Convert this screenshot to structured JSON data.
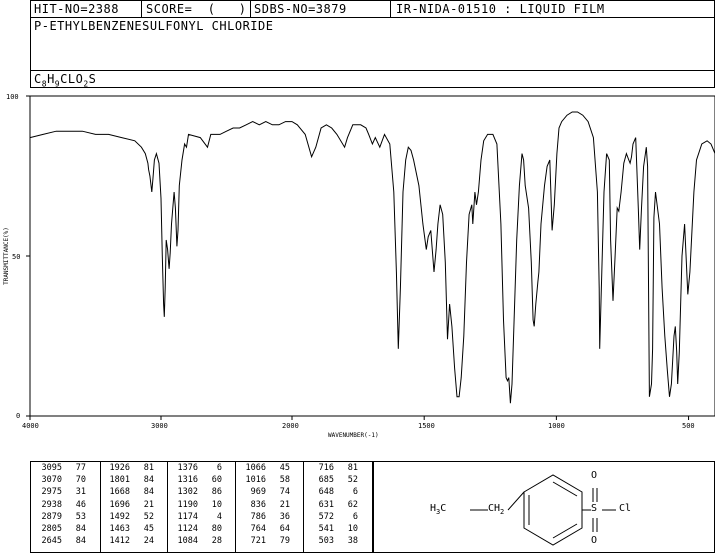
{
  "header": {
    "hit_no": "HIT-NO=2388",
    "score": "SCORE=  (   )",
    "sdbs_no": "SDBS-NO=3879",
    "ir_info": "IR-NIDA-01510 : LIQUID FILM",
    "compound": "P-ETHYLBENZENESULFONYL CHLORIDE",
    "formula_parts": [
      "C",
      "8",
      "H",
      "9",
      "CLO",
      "2",
      "S"
    ]
  },
  "chart_data": {
    "type": "line",
    "xlabel": "WAVENUMBER(-1)",
    "ylabel": "TRANSMITTANCE(%)",
    "x_ticks": [
      "4000",
      "3000",
      "2000",
      "1500",
      "1000",
      "500"
    ],
    "y_ticks": [
      "100",
      "50",
      "0"
    ],
    "xlim": [
      4000,
      400
    ],
    "ylim": [
      0,
      100
    ],
    "series": [
      {
        "points": [
          [
            4000,
            87
          ],
          [
            3900,
            88
          ],
          [
            3800,
            89
          ],
          [
            3700,
            89
          ],
          [
            3600,
            89
          ],
          [
            3500,
            88
          ],
          [
            3400,
            88
          ],
          [
            3300,
            87
          ],
          [
            3200,
            86
          ],
          [
            3150,
            84
          ],
          [
            3120,
            82
          ],
          [
            3100,
            79
          ],
          [
            3095,
            77
          ],
          [
            3085,
            75
          ],
          [
            3070,
            70
          ],
          [
            3062,
            74
          ],
          [
            3050,
            80
          ],
          [
            3035,
            82
          ],
          [
            3015,
            79
          ],
          [
            3000,
            68
          ],
          [
            2990,
            50
          ],
          [
            2980,
            35
          ],
          [
            2975,
            31
          ],
          [
            2968,
            40
          ],
          [
            2960,
            55
          ],
          [
            2950,
            52
          ],
          [
            2938,
            46
          ],
          [
            2930,
            51
          ],
          [
            2920,
            60
          ],
          [
            2900,
            70
          ],
          [
            2890,
            65
          ],
          [
            2879,
            53
          ],
          [
            2870,
            58
          ],
          [
            2860,
            72
          ],
          [
            2840,
            80
          ],
          [
            2820,
            85
          ],
          [
            2805,
            84
          ],
          [
            2790,
            88
          ],
          [
            2700,
            87
          ],
          [
            2645,
            84
          ],
          [
            2620,
            88
          ],
          [
            2550,
            88
          ],
          [
            2500,
            89
          ],
          [
            2450,
            90
          ],
          [
            2400,
            90
          ],
          [
            2350,
            91
          ],
          [
            2300,
            92
          ],
          [
            2250,
            91
          ],
          [
            2200,
            92
          ],
          [
            2150,
            91
          ],
          [
            2100,
            91
          ],
          [
            2050,
            92
          ],
          [
            2000,
            92
          ],
          [
            1980,
            91
          ],
          [
            1950,
            88
          ],
          [
            1926,
            81
          ],
          [
            1910,
            84
          ],
          [
            1890,
            90
          ],
          [
            1870,
            91
          ],
          [
            1850,
            90
          ],
          [
            1830,
            88
          ],
          [
            1801,
            84
          ],
          [
            1790,
            87
          ],
          [
            1770,
            91
          ],
          [
            1740,
            91
          ],
          [
            1720,
            90
          ],
          [
            1710,
            88
          ],
          [
            1696,
            85
          ],
          [
            1685,
            87
          ],
          [
            1668,
            84
          ],
          [
            1650,
            88
          ],
          [
            1630,
            85
          ],
          [
            1615,
            70
          ],
          [
            1605,
            45
          ],
          [
            1598,
            21
          ],
          [
            1590,
            40
          ],
          [
            1580,
            70
          ],
          [
            1570,
            80
          ],
          [
            1560,
            84
          ],
          [
            1550,
            83
          ],
          [
            1540,
            80
          ],
          [
            1520,
            72
          ],
          [
            1505,
            60
          ],
          [
            1492,
            52
          ],
          [
            1485,
            56
          ],
          [
            1475,
            58
          ],
          [
            1463,
            45
          ],
          [
            1455,
            52
          ],
          [
            1448,
            60
          ],
          [
            1440,
            66
          ],
          [
            1430,
            63
          ],
          [
            1420,
            48
          ],
          [
            1412,
            24
          ],
          [
            1404,
            35
          ],
          [
            1395,
            28
          ],
          [
            1385,
            15
          ],
          [
            1376,
            6
          ],
          [
            1368,
            6
          ],
          [
            1360,
            12
          ],
          [
            1350,
            25
          ],
          [
            1340,
            48
          ],
          [
            1330,
            63
          ],
          [
            1320,
            66
          ],
          [
            1316,
            60
          ],
          [
            1308,
            70
          ],
          [
            1302,
            66
          ],
          [
            1295,
            70
          ],
          [
            1285,
            80
          ],
          [
            1275,
            86
          ],
          [
            1260,
            88
          ],
          [
            1240,
            88
          ],
          [
            1225,
            85
          ],
          [
            1210,
            60
          ],
          [
            1200,
            30
          ],
          [
            1190,
            12
          ],
          [
            1185,
            11
          ],
          [
            1180,
            12
          ],
          [
            1174,
            4
          ],
          [
            1168,
            10
          ],
          [
            1160,
            30
          ],
          [
            1150,
            55
          ],
          [
            1140,
            72
          ],
          [
            1130,
            82
          ],
          [
            1124,
            80
          ],
          [
            1118,
            72
          ],
          [
            1105,
            65
          ],
          [
            1095,
            48
          ],
          [
            1088,
            30
          ],
          [
            1084,
            28
          ],
          [
            1078,
            35
          ],
          [
            1070,
            42
          ],
          [
            1066,
            45
          ],
          [
            1058,
            60
          ],
          [
            1045,
            72
          ],
          [
            1035,
            78
          ],
          [
            1025,
            80
          ],
          [
            1016,
            58
          ],
          [
            1008,
            66
          ],
          [
            998,
            82
          ],
          [
            990,
            90
          ],
          [
            980,
            92
          ],
          [
            960,
            94
          ],
          [
            940,
            95
          ],
          [
            920,
            95
          ],
          [
            900,
            94
          ],
          [
            880,
            92
          ],
          [
            860,
            87
          ],
          [
            845,
            70
          ],
          [
            838,
            40
          ],
          [
            836,
            21
          ],
          [
            828,
            45
          ],
          [
            820,
            70
          ],
          [
            810,
            82
          ],
          [
            800,
            80
          ],
          [
            795,
            55
          ],
          [
            786,
            36
          ],
          [
            778,
            50
          ],
          [
            770,
            65
          ],
          [
            764,
            64
          ],
          [
            755,
            70
          ],
          [
            745,
            79
          ],
          [
            735,
            82
          ],
          [
            726,
            80
          ],
          [
            721,
            79
          ],
          [
            716,
            81
          ],
          [
            710,
            85
          ],
          [
            700,
            87
          ],
          [
            690,
            65
          ],
          [
            685,
            52
          ],
          [
            678,
            65
          ],
          [
            670,
            78
          ],
          [
            660,
            84
          ],
          [
            655,
            78
          ],
          [
            648,
            6
          ],
          [
            640,
            10
          ],
          [
            636,
            21
          ],
          [
            631,
            62
          ],
          [
            625,
            70
          ],
          [
            610,
            60
          ],
          [
            600,
            40
          ],
          [
            590,
            25
          ],
          [
            580,
            14
          ],
          [
            572,
            6
          ],
          [
            565,
            10
          ],
          [
            555,
            25
          ],
          [
            550,
            28
          ],
          [
            545,
            20
          ],
          [
            541,
            10
          ],
          [
            535,
            20
          ],
          [
            525,
            50
          ],
          [
            515,
            60
          ],
          [
            503,
            38
          ],
          [
            495,
            45
          ],
          [
            480,
            70
          ],
          [
            470,
            80
          ],
          [
            450,
            85
          ],
          [
            430,
            86
          ],
          [
            415,
            85
          ],
          [
            400,
            82
          ]
        ]
      }
    ]
  },
  "peak_table": [
    [
      [
        "3095",
        "77"
      ],
      [
        "3070",
        "70"
      ],
      [
        "2975",
        "31"
      ],
      [
        "2938",
        "46"
      ],
      [
        "2879",
        "53"
      ],
      [
        "2805",
        "84"
      ],
      [
        "2645",
        "84"
      ]
    ],
    [
      [
        "1926",
        "81"
      ],
      [
        "1801",
        "84"
      ],
      [
        "1668",
        "84"
      ],
      [
        "1696",
        "21"
      ],
      [
        "1492",
        "52"
      ],
      [
        "1463",
        "45"
      ],
      [
        "1412",
        "24"
      ]
    ],
    [
      [
        "1376",
        "6"
      ],
      [
        "1316",
        "60"
      ],
      [
        "1302",
        "86"
      ],
      [
        "1190",
        "10"
      ],
      [
        "1174",
        "4"
      ],
      [
        "1124",
        "80"
      ],
      [
        "1084",
        "28"
      ]
    ],
    [
      [
        "1066",
        "45"
      ],
      [
        "1016",
        "58"
      ],
      [
        "969",
        "74"
      ],
      [
        "836",
        "21"
      ],
      [
        "786",
        "36"
      ],
      [
        "764",
        "64"
      ],
      [
        "721",
        "79"
      ]
    ],
    [
      [
        "716",
        "81"
      ],
      [
        "685",
        "52"
      ],
      [
        "648",
        "6"
      ],
      [
        "631",
        "62"
      ],
      [
        "572",
        "6"
      ],
      [
        "541",
        "10"
      ],
      [
        "503",
        "38"
      ]
    ]
  ],
  "structure": {
    "left_group": "H3C",
    "left_group_parts": [
      "H",
      "3",
      "C"
    ],
    "chain_group": "CH2",
    "chain_group_parts": [
      "CH",
      "2"
    ],
    "sulfur": "S",
    "oxygen_top": "O",
    "oxygen_bottom": "O",
    "chlorine": "Cl"
  }
}
